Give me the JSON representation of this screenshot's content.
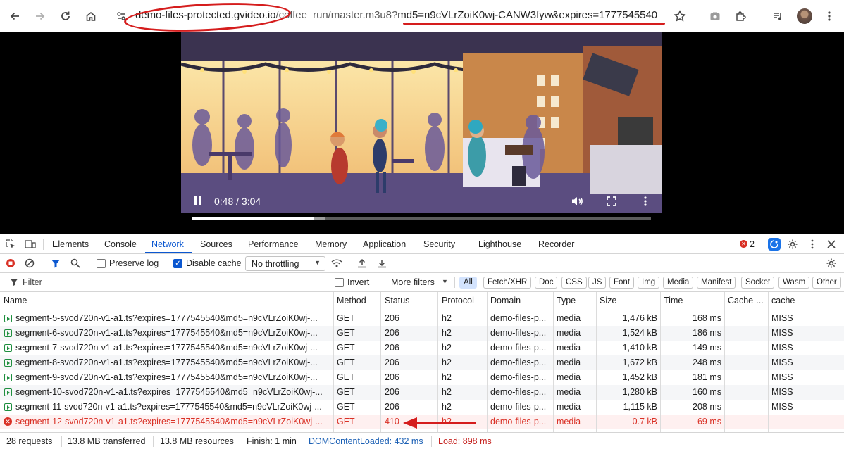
{
  "browser": {
    "url_host": "demo-files-protected.gvideo.io",
    "url_path": "/coffee_run/master.m3u8?",
    "url_query": "md5=n9cVLrZoiK0wj-CANW3fyw&expires=1777545540"
  },
  "video": {
    "time_display": "0:48 / 3:04",
    "progress_fraction": 0.265,
    "buffer_fraction": 0.29
  },
  "devtools": {
    "tabs": [
      "Elements",
      "Console",
      "Network",
      "Sources",
      "Performance",
      "Memory",
      "Application",
      "Security",
      "Lighthouse",
      "Recorder"
    ],
    "active_tab": "Network",
    "error_count": "2",
    "toolbar": {
      "preserve_log": "Preserve log",
      "disable_cache": "Disable cache",
      "throttling": "No throttling"
    },
    "filter_bar": {
      "filter_placeholder": "Filter",
      "invert": "Invert",
      "more_filters": "More filters",
      "types": [
        "All",
        "Fetch/XHR",
        "Doc",
        "CSS",
        "JS",
        "Font",
        "Img",
        "Media",
        "Manifest",
        "Socket",
        "Wasm",
        "Other"
      ]
    },
    "columns": [
      "Name",
      "Method",
      "Status",
      "Protocol",
      "Domain",
      "Type",
      "Size",
      "Time",
      "Cache-...",
      "cache"
    ],
    "rows": [
      {
        "name": "segment-5-svod720n-v1-a1.ts?expires=1777545540&md5=n9cVLrZoiK0wj-...",
        "method": "GET",
        "status": "206",
        "protocol": "h2",
        "domain": "demo-files-p...",
        "type": "media",
        "size": "1,476 kB",
        "time": "168 ms",
        "cache_ctrl": "",
        "cache": "MISS",
        "error": false
      },
      {
        "name": "segment-6-svod720n-v1-a1.ts?expires=1777545540&md5=n9cVLrZoiK0wj-...",
        "method": "GET",
        "status": "206",
        "protocol": "h2",
        "domain": "demo-files-p...",
        "type": "media",
        "size": "1,524 kB",
        "time": "186 ms",
        "cache_ctrl": "",
        "cache": "MISS",
        "error": false
      },
      {
        "name": "segment-7-svod720n-v1-a1.ts?expires=1777545540&md5=n9cVLrZoiK0wj-...",
        "method": "GET",
        "status": "206",
        "protocol": "h2",
        "domain": "demo-files-p...",
        "type": "media",
        "size": "1,410 kB",
        "time": "149 ms",
        "cache_ctrl": "",
        "cache": "MISS",
        "error": false
      },
      {
        "name": "segment-8-svod720n-v1-a1.ts?expires=1777545540&md5=n9cVLrZoiK0wj-...",
        "method": "GET",
        "status": "206",
        "protocol": "h2",
        "domain": "demo-files-p...",
        "type": "media",
        "size": "1,672 kB",
        "time": "248 ms",
        "cache_ctrl": "",
        "cache": "MISS",
        "error": false
      },
      {
        "name": "segment-9-svod720n-v1-a1.ts?expires=1777545540&md5=n9cVLrZoiK0wj-...",
        "method": "GET",
        "status": "206",
        "protocol": "h2",
        "domain": "demo-files-p...",
        "type": "media",
        "size": "1,452 kB",
        "time": "181 ms",
        "cache_ctrl": "",
        "cache": "MISS",
        "error": false
      },
      {
        "name": "segment-10-svod720n-v1-a1.ts?expires=1777545540&md5=n9cVLrZoiK0wj-...",
        "method": "GET",
        "status": "206",
        "protocol": "h2",
        "domain": "demo-files-p...",
        "type": "media",
        "size": "1,280 kB",
        "time": "160 ms",
        "cache_ctrl": "",
        "cache": "MISS",
        "error": false
      },
      {
        "name": "segment-11-svod720n-v1-a1.ts?expires=1777545540&md5=n9cVLrZoiK0wj-...",
        "method": "GET",
        "status": "206",
        "protocol": "h2",
        "domain": "demo-files-p...",
        "type": "media",
        "size": "1,115 kB",
        "time": "208 ms",
        "cache_ctrl": "",
        "cache": "MISS",
        "error": false
      },
      {
        "name": "segment-12-svod720n-v1-a1.ts?expires=1777545540&md5=n9cVLrZoiK0wj-...",
        "method": "GET",
        "status": "410",
        "protocol": "h2",
        "domain": "demo-files-p...",
        "type": "media",
        "size": "0.7 kB",
        "time": "69 ms",
        "cache_ctrl": "",
        "cache": "",
        "error": true
      }
    ],
    "status_bar": {
      "requests": "28 requests",
      "transferred": "13.8 MB transferred",
      "resources": "13.8 MB resources",
      "finish": "Finish: 1 min",
      "dom_loaded": "DOMContentLoaded: 432 ms",
      "load": "Load: 898 ms"
    }
  },
  "colors": {
    "annotation": "#d51d1d",
    "accent": "#0b57d0",
    "error": "#d93025",
    "success": "#1e8e3e"
  }
}
